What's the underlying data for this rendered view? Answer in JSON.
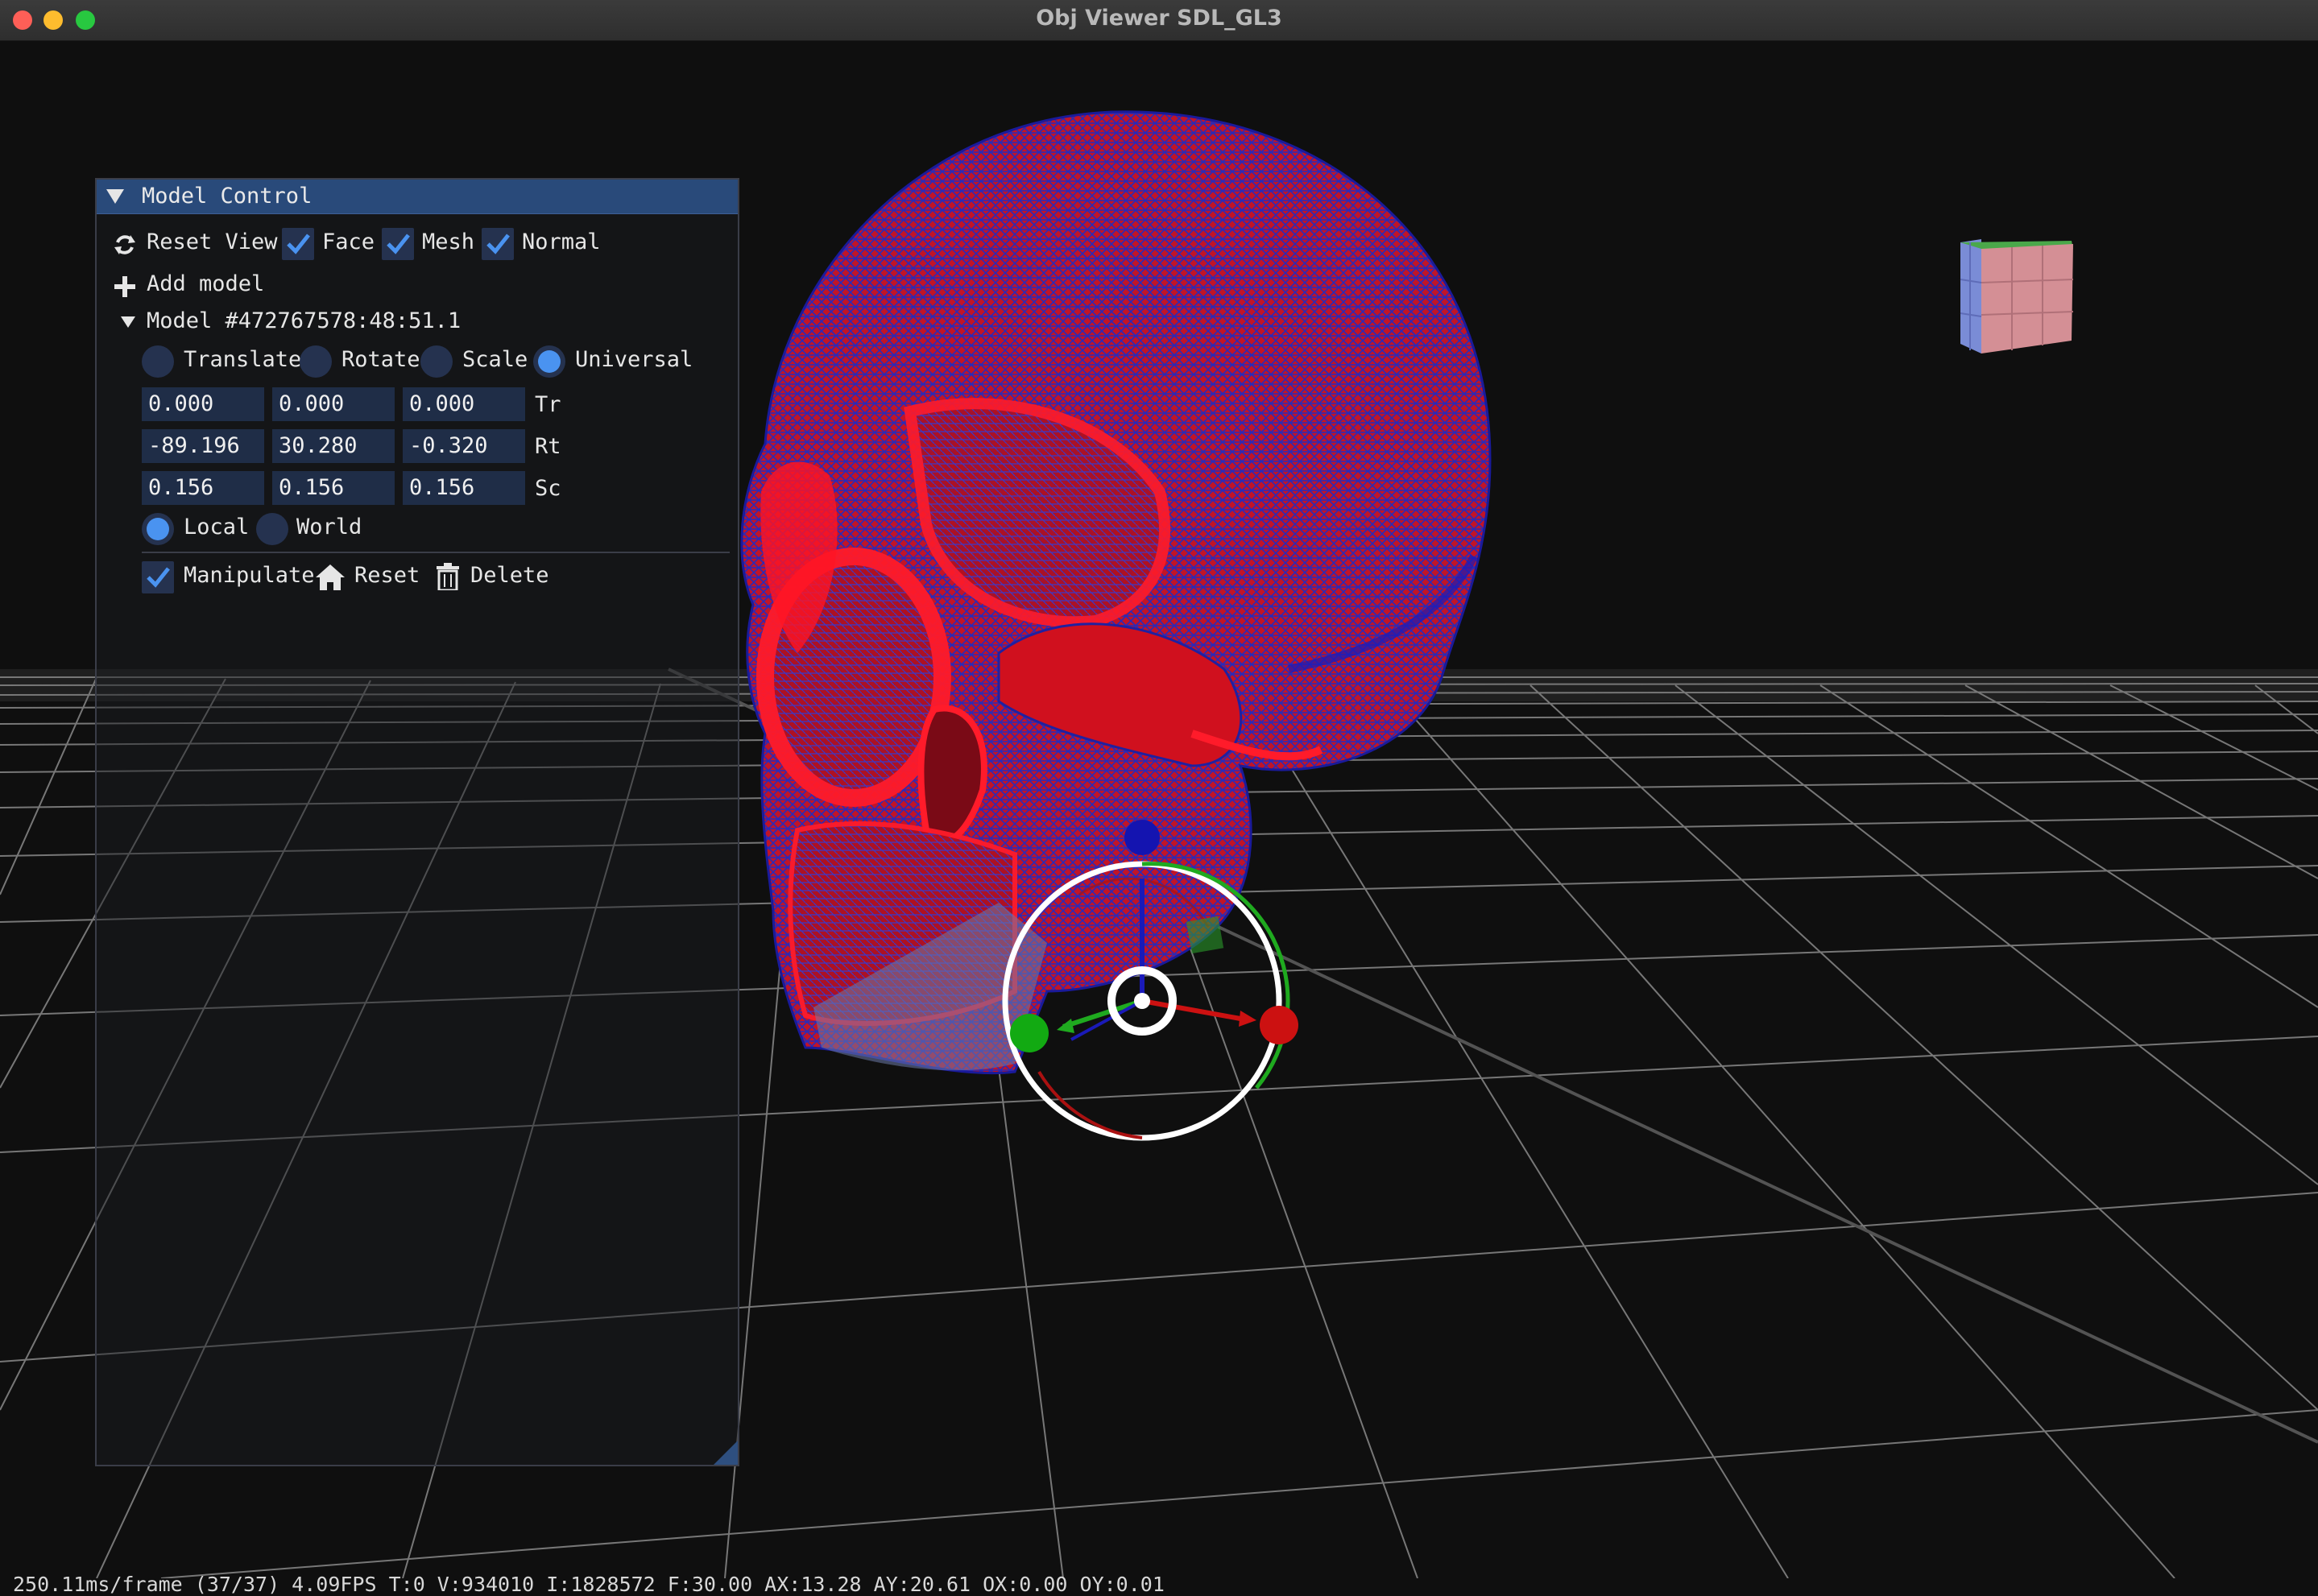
{
  "window": {
    "title": "Obj Viewer SDL_GL3"
  },
  "panel": {
    "title": "Model Control",
    "reset_view": "Reset View",
    "face": "Face",
    "mesh": "Mesh",
    "normal": "Normal",
    "add_model": "Add model",
    "model_node": "Model #472767578:48:51.1",
    "mode_translate": "Translate",
    "mode_rotate": "Rotate",
    "mode_scale": "Scale",
    "mode_universal": "Universal",
    "translate": [
      "0.000",
      "0.000",
      "0.000"
    ],
    "translate_label": "Tr",
    "rotate": [
      "-89.196",
      "30.280",
      "-0.320"
    ],
    "rotate_label": "Rt",
    "scale": [
      "0.156",
      "0.156",
      "0.156"
    ],
    "scale_label": "Sc",
    "space_local": "Local",
    "space_world": "World",
    "manipulate": "Manipulate",
    "reset": "Reset",
    "delete": "Delete"
  },
  "state": {
    "face_checked": true,
    "mesh_checked": true,
    "normal_checked": true,
    "mode": "Universal",
    "space": "Local",
    "manipulate_checked": true
  },
  "status": "250.11ms/frame (37/37) 4.09FPS T:0 V:934010 I:1828572 F:30.00 AX:13.28 AY:20.61 OX:0.00 OY:0.01",
  "colors": {
    "panel_header": "#294a7a",
    "accent": "#4a93f0",
    "mesh_red": "#e0101c",
    "mesh_blue": "#2a2ab8",
    "gizmo_x": "#cc1111",
    "gizmo_y": "#1faa1f",
    "gizmo_z": "#1a1ab8"
  },
  "icons": [
    "refresh-icon",
    "plus-icon",
    "home-icon",
    "trash-icon",
    "checkmark-icon",
    "view-cube-icon"
  ]
}
